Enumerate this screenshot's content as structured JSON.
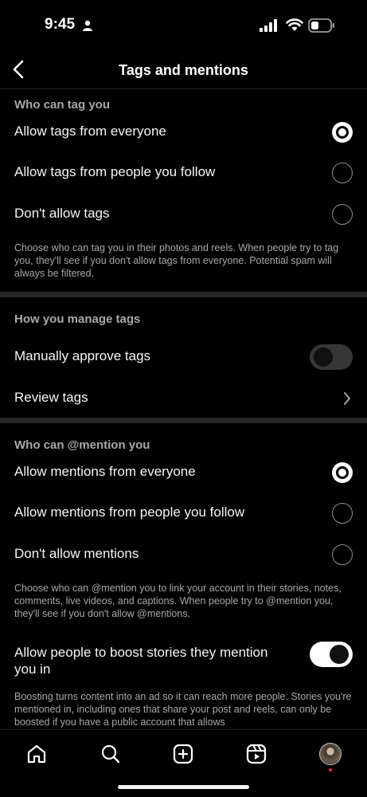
{
  "status_bar": {
    "time": "9:45"
  },
  "header": {
    "title": "Tags and mentions"
  },
  "tags_section": {
    "header": "Who can tag you",
    "options": [
      {
        "label": "Allow tags from everyone",
        "selected": true
      },
      {
        "label": "Allow tags from people you follow",
        "selected": false
      },
      {
        "label": "Don't allow tags",
        "selected": false
      }
    ],
    "helper": "Choose who can tag you in their photos and reels. When people try to tag you, they'll see if you don't allow tags from everyone. Potential spam will always be filtered."
  },
  "manage_section": {
    "header": "How you manage tags",
    "manual_approve_label": "Manually approve tags",
    "manual_approve_on": false,
    "review_tags_label": "Review tags"
  },
  "mentions_section": {
    "header": "Who can @mention you",
    "options": [
      {
        "label": "Allow mentions from everyone",
        "selected": true
      },
      {
        "label": "Allow mentions from people you follow",
        "selected": false
      },
      {
        "label": "Don't allow mentions",
        "selected": false
      }
    ],
    "helper": "Choose who can @mention you to link your account in their stories, notes, comments, live videos, and captions. When people try to @mention you, they'll see if you don't allow @mentions.",
    "boost_label": "Allow people to boost stories they mention you in",
    "boost_on": true,
    "boost_helper": "Boosting turns content into an ad so it can reach more people. Stories you're mentioned in, including ones that share your post and reels, can only be boosted if you have a public account that allows"
  },
  "tab_bar": {
    "icons": [
      "home-icon",
      "search-icon",
      "create-icon",
      "reels-icon",
      "profile-avatar"
    ]
  }
}
